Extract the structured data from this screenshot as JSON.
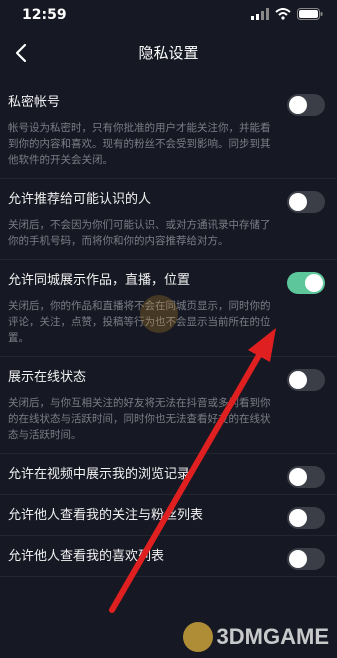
{
  "status_bar": {
    "time": "12:59"
  },
  "nav": {
    "title": "隐私设置",
    "back_icon": "chevron-left-icon"
  },
  "settings": [
    {
      "label": "私密帐号",
      "desc": "帐号设为私密时，只有你批准的用户才能关注你，并能看到你的内容和喜欢。现有的粉丝不会受到影响。同步到其他软件的开关会关闭。",
      "on": false
    },
    {
      "label": "允许推荐给可能认识的人",
      "desc": "关闭后，不会因为你们可能认识、或对方通讯录中存储了你的手机号码，而将你和你的内容推荐给对方。",
      "on": false
    },
    {
      "label": "允许同城展示作品，直播，位置",
      "desc": "关闭后，你的作品和直播将不会在同城页显示，同时你的评论，关注，点赞，投稿等行为也不会显示当前所在的位置。",
      "on": true
    },
    {
      "label": "展示在线状态",
      "desc": "关闭后，与你互相关注的好友将无法在抖音或多闪看到你的在线状态与活跃时间，同时你也无法查看好友的在线状态与活跃时间。",
      "on": false
    },
    {
      "label": "允许在视频中展示我的浏览记录",
      "desc": "",
      "on": false
    },
    {
      "label": "允许他人查看我的关注与粉丝列表",
      "desc": "",
      "on": false
    },
    {
      "label": "允许他人查看我的喜欢列表",
      "desc": "",
      "on": false
    }
  ],
  "watermark": {
    "text": "3DMGAME"
  },
  "colors": {
    "background": "#161823",
    "toggle_on": "#5dc69b",
    "toggle_off": "#3b3d47",
    "arrow": "#e02020"
  }
}
